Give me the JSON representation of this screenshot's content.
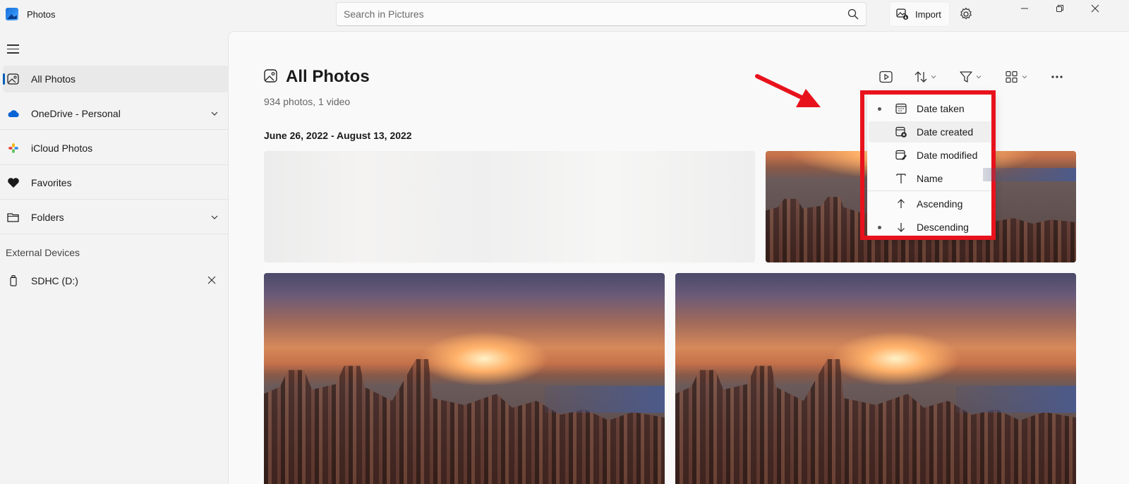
{
  "app": {
    "title": "Photos"
  },
  "search": {
    "placeholder": "Search in Pictures"
  },
  "toolbar": {
    "import_label": "Import"
  },
  "sidebar": {
    "items": [
      {
        "label": "All Photos"
      },
      {
        "label": "OneDrive - Personal"
      },
      {
        "label": "iCloud Photos"
      },
      {
        "label": "Favorites"
      },
      {
        "label": "Folders"
      }
    ],
    "section_label": "External Devices",
    "devices": [
      {
        "label": "SDHC (D:)"
      }
    ]
  },
  "main": {
    "title": "All Photos",
    "subtitle": "934 photos, 1 video",
    "date_range": "June 26, 2022 - August 13, 2022"
  },
  "sort_menu": {
    "sort_by": [
      {
        "label": "Date taken",
        "icon": "calendar-icon",
        "selected": true
      },
      {
        "label": "Date created",
        "icon": "date-created-icon",
        "selected": false
      },
      {
        "label": "Date modified",
        "icon": "date-modified-icon",
        "selected": false
      },
      {
        "label": "Name",
        "icon": "text-icon",
        "selected": false
      }
    ],
    "order": [
      {
        "label": "Ascending",
        "icon": "arrow-up-icon",
        "selected": false
      },
      {
        "label": "Descending",
        "icon": "arrow-down-icon",
        "selected": true
      }
    ]
  },
  "colors": {
    "accent": "#005fb8",
    "annotation": "#e8121c"
  }
}
